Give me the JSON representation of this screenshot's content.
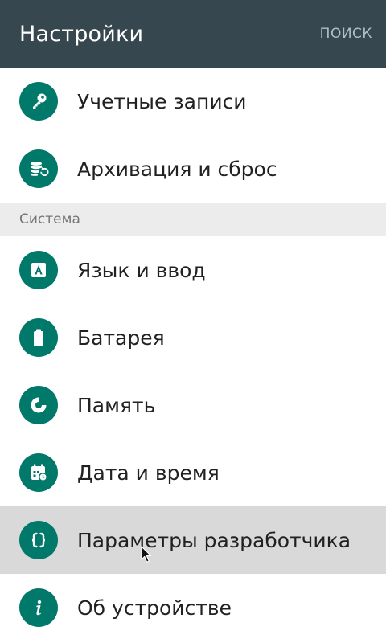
{
  "appbar": {
    "title": "Настройки",
    "action": "ПОИСК"
  },
  "colors": {
    "appbar_bg": "#37474f",
    "icon_bg": "#00796b",
    "section_bg": "#ececec",
    "selected_bg": "#d9d9d9"
  },
  "accounts_group": {
    "items": [
      {
        "label": "Учетные записи",
        "icon": "key-icon"
      },
      {
        "label": "Архивация и сброс",
        "icon": "backup-restore-icon"
      }
    ]
  },
  "system_section": {
    "header": "Система",
    "items": [
      {
        "label": "Язык и ввод",
        "icon": "language-icon"
      },
      {
        "label": "Батарея",
        "icon": "battery-icon"
      },
      {
        "label": "Память",
        "icon": "storage-icon"
      },
      {
        "label": "Дата и время",
        "icon": "calendar-clock-icon"
      },
      {
        "label": "Параметры разработчика",
        "icon": "braces-icon",
        "selected": true
      },
      {
        "label": "Об устройстве",
        "icon": "info-icon"
      }
    ]
  }
}
